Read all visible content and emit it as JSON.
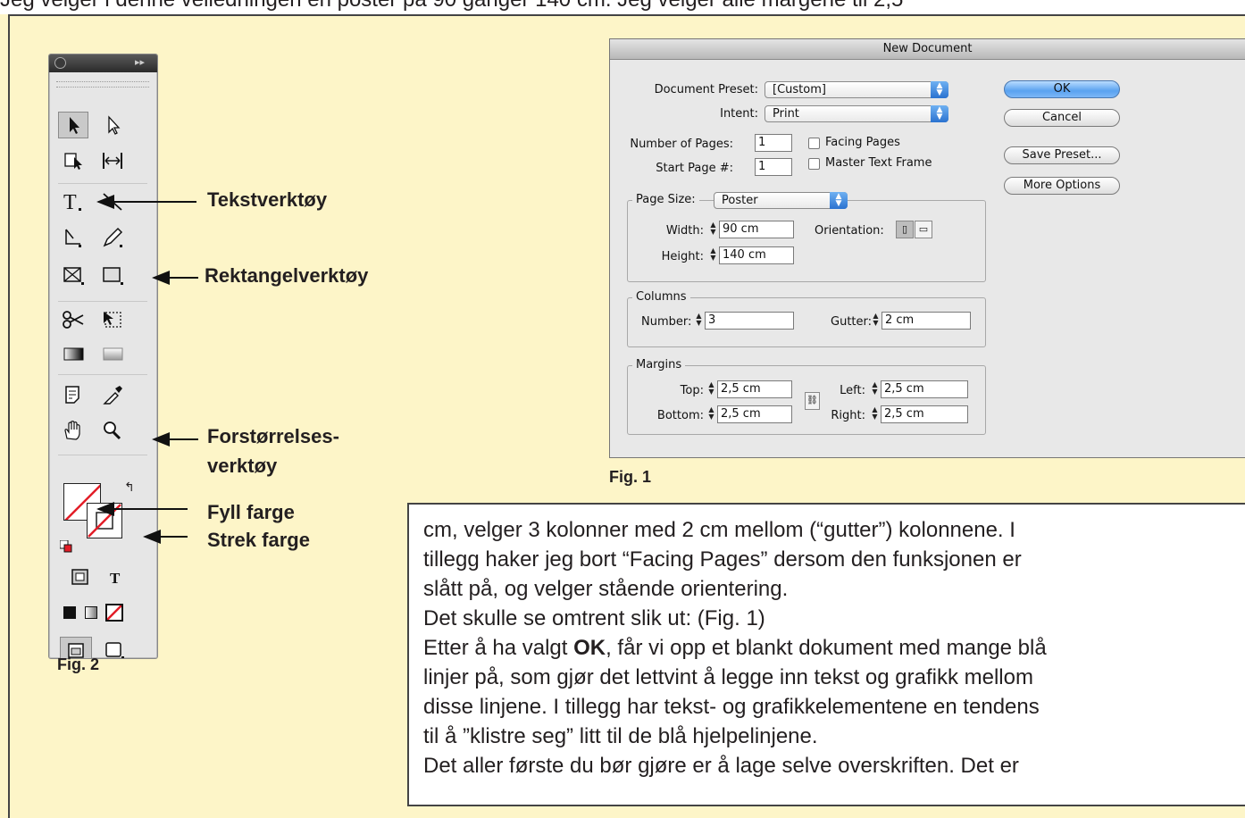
{
  "header_fragment": "Jeg velger i denne veiledningen en poster på 90 ganger 140 cm. Jeg velger alle margene til 2,5",
  "toolbox": {
    "tools": [
      "selection-tool",
      "direct-selection-tool",
      "page-tool",
      "gap-tool",
      "type-tool",
      "line-tool",
      "pen-tool",
      "pencil-tool",
      "rectangle-frame-tool",
      "rectangle-tool",
      "scissors-tool",
      "free-transform-tool",
      "gradient-swatch-tool",
      "gradient-feather-tool",
      "note-tool",
      "eyedropper-tool",
      "hand-tool",
      "zoom-tool"
    ]
  },
  "callouts": {
    "text_tool": "Tekstverktøy",
    "rect_tool": "Rektangelverktøy",
    "zoom_line1": "Forstørrelses-",
    "zoom_line2": "verktøy",
    "fill": "Fyll farge",
    "stroke": "Strek farge"
  },
  "fig1": "Fig. 1",
  "fig2": "Fig. 2",
  "dialog": {
    "title": "New Document",
    "preset_label": "Document Preset:",
    "preset_value": "[Custom]",
    "intent_label": "Intent:",
    "intent_value": "Print",
    "pages_label": "Number of Pages:",
    "pages_value": "1",
    "start_label": "Start Page #:",
    "start_value": "1",
    "facing_label": "Facing Pages",
    "facing_checked": false,
    "master_label": "Master Text Frame",
    "master_checked": false,
    "page_size_label": "Page Size:",
    "page_size_value": "Poster",
    "width_label": "Width:",
    "width_value": "90 cm",
    "height_label": "Height:",
    "height_value": "140 cm",
    "orientation_label": "Orientation:",
    "columns_title": "Columns",
    "number_label": "Number:",
    "number_value": "3",
    "gutter_label": "Gutter:",
    "gutter_value": "2 cm",
    "margins_title": "Margins",
    "top_label": "Top:",
    "top_value": "2,5 cm",
    "bottom_label": "Bottom:",
    "bottom_value": "2,5 cm",
    "left_label": "Left:",
    "left_value": "2,5 cm",
    "right_label": "Right:",
    "right_value": "2,5 cm",
    "ok": "OK",
    "cancel": "Cancel",
    "save_preset": "Save Preset...",
    "more_options": "More Options"
  },
  "body_text": {
    "line1": "cm, velger 3 kolonner med 2 cm mellom (“gutter”) kolonnene. I",
    "line2": "tillegg haker jeg bort “Facing Pages” dersom den funksjonen er",
    "line3": "slått på, og velger stående orientering.",
    "line4": "Det skulle se omtrent slik ut: (Fig. 1)",
    "line5_a": "Etter å ha valgt ",
    "line5_b": "OK",
    "line5_c": ", får vi opp et blankt dokument med mange blå",
    "line6": "linjer på, som gjør det lettvint å legge inn tekst og grafikk mellom",
    "line7": "disse linjene. I tillegg har tekst- og grafikkelementene en tendens",
    "line8": "til å ”klistre seg” litt til de blå hjelpelinjene.",
    "line9": "Det aller første du bør gjøre er å lage selve overskriften. Det er"
  }
}
